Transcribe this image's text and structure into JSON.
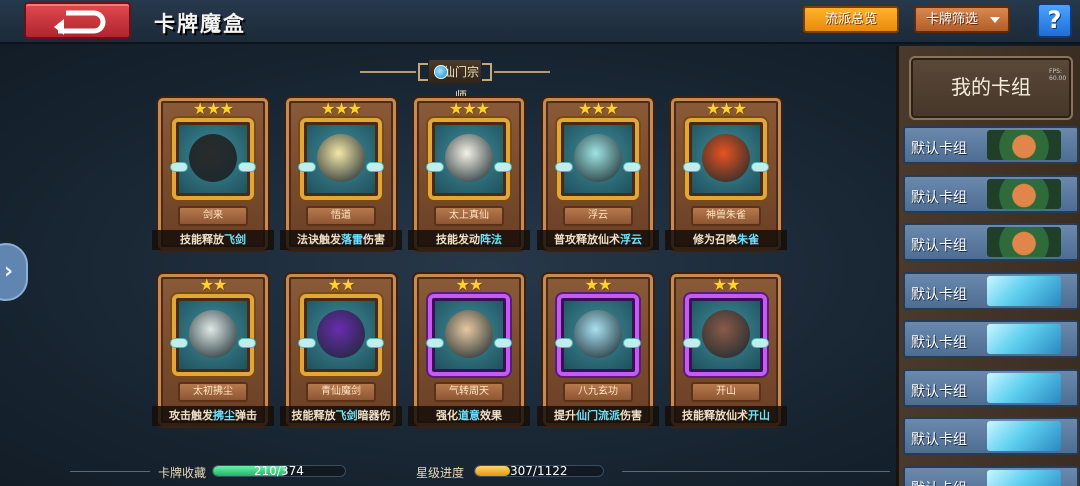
{
  "header": {
    "title": "卡牌魔盒",
    "overview_button": "流派总览",
    "filter_button": "卡牌筛选",
    "help_button": "?"
  },
  "faction": {
    "name": "仙门宗师"
  },
  "cards": [
    {
      "name": "剑来",
      "stars": "★★★",
      "desc_a": "技能释放",
      "desc_b": "飞剑",
      "desc_c": "",
      "rarity": "gold",
      "art_color": "#2b2b2b"
    },
    {
      "name": "悟道",
      "stars": "★★★",
      "desc_a": "法诀触发",
      "desc_b": "落雷",
      "desc_c": "伤害",
      "rarity": "gold",
      "art_color": "#f6e6a8"
    },
    {
      "name": "太上真仙",
      "stars": "★★★",
      "desc_a": "技能发动",
      "desc_b": "阵法",
      "desc_c": "",
      "rarity": "gold",
      "art_color": "#f4f1e6"
    },
    {
      "name": "浮云",
      "stars": "★★★",
      "desc_a": "普攻释放仙术",
      "desc_b": "浮云",
      "desc_c": "",
      "rarity": "gold",
      "art_color": "#9fe4e2"
    },
    {
      "name": "神兽朱雀",
      "stars": "★★★",
      "desc_a": "修为召唤",
      "desc_b": "朱雀",
      "desc_c": "",
      "rarity": "gold",
      "art_color": "#e8531f"
    },
    {
      "name": "太初拂尘",
      "stars": "★★",
      "desc_a": "攻击触发",
      "desc_b": "拂尘",
      "desc_c": "弹击",
      "rarity": "gold",
      "art_color": "#dfe9e6"
    },
    {
      "name": "青仙魔剑",
      "stars": "★★",
      "desc_a": "技能释放",
      "desc_b": "飞剑",
      "desc_c": "暗器伤",
      "rarity": "gold",
      "art_color": "#6a2bb0"
    },
    {
      "name": "气转周天",
      "stars": "★★",
      "desc_a": "强化",
      "desc_b": "道意",
      "desc_c": "效果",
      "rarity": "epic",
      "art_color": "#e8c9a0"
    },
    {
      "name": "八九玄功",
      "stars": "★★",
      "desc_a": "提升",
      "desc_b": "仙门流派",
      "desc_c": "伤害",
      "rarity": "epic",
      "art_color": "#a8e0f0"
    },
    {
      "name": "开山",
      "stars": "★★",
      "desc_a": "技能释放仙术",
      "desc_b": "开山",
      "desc_c": "",
      "rarity": "epic",
      "art_color": "#8a5a48"
    }
  ],
  "progress": {
    "collection_label": "卡牌收藏",
    "collection_value": "210/374",
    "collection_fraction": 0.561,
    "star_label": "星级进度",
    "star_value": "307/1122",
    "star_fraction": 0.274
  },
  "deck_panel": {
    "title": "我的卡组",
    "fps": "FPS: 60.00",
    "items": [
      {
        "label": "默认卡组",
        "thumb": "deer"
      },
      {
        "label": "默认卡组",
        "thumb": "deer"
      },
      {
        "label": "默认卡组",
        "thumb": "deer"
      },
      {
        "label": "默认卡组",
        "thumb": "ice"
      },
      {
        "label": "默认卡组",
        "thumb": "ice"
      },
      {
        "label": "默认卡组",
        "thumb": "ice"
      },
      {
        "label": "默认卡组",
        "thumb": "ice"
      },
      {
        "label": "默认卡组",
        "thumb": "ice"
      }
    ]
  },
  "colors": {
    "accent_orange": "#f29a1a",
    "help_blue": "#2f86f0",
    "back_red": "#c83038",
    "progress_green": "#39d37e",
    "progress_gold": "#f2b52a"
  }
}
